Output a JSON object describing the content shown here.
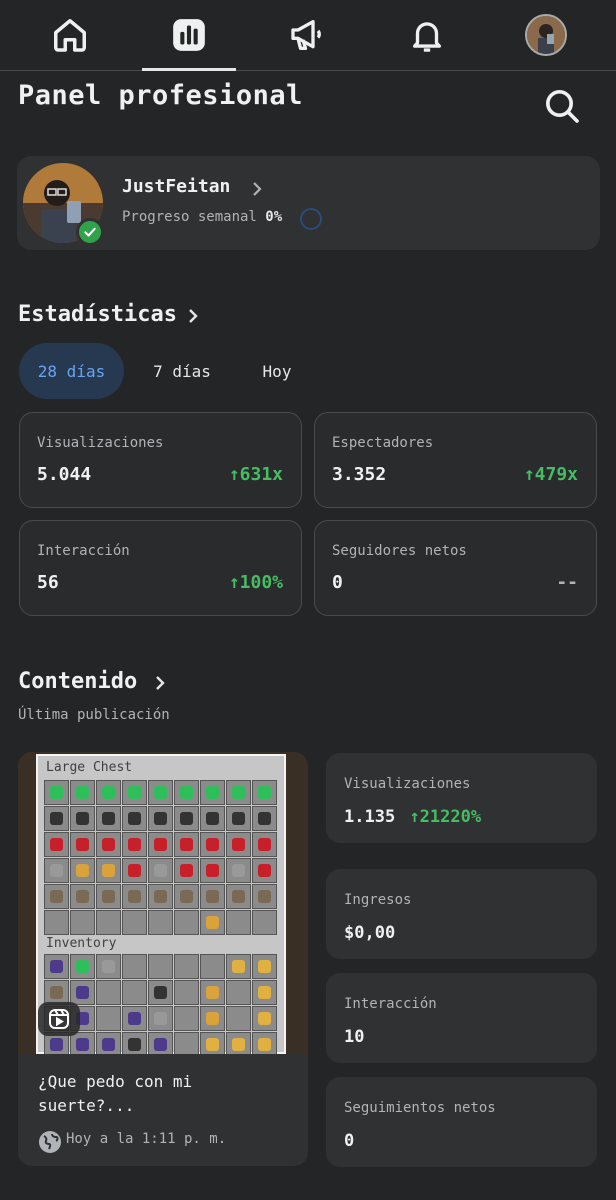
{
  "nav": {
    "items": [
      {
        "icon": "home-icon",
        "active": false
      },
      {
        "icon": "dashboard-icon",
        "active": true
      },
      {
        "icon": "megaphone-icon",
        "active": false
      },
      {
        "icon": "bell-icon",
        "active": false
      },
      {
        "icon": "profile-avatar",
        "active": false
      }
    ]
  },
  "page": {
    "title": "Panel profesional"
  },
  "profile": {
    "name": "JustFeitan",
    "progress_label": "Progreso semanal",
    "progress_value": "0%"
  },
  "stats": {
    "title": "Estadísticas",
    "tabs": [
      "28 días",
      "7 días",
      "Hoy"
    ],
    "active_tab": "28 días",
    "cards": [
      {
        "label": "Visualizaciones",
        "value": "5.044",
        "change": "↑631x"
      },
      {
        "label": "Espectadores",
        "value": "3.352",
        "change": "↑479x"
      },
      {
        "label": "Interacción",
        "value": "56",
        "change": "↑100%"
      },
      {
        "label": "Seguidores netos",
        "value": "0",
        "change": "--"
      }
    ]
  },
  "content": {
    "title": "Contenido",
    "subtitle": "Última publicación",
    "post": {
      "thumb_chest_label": "Large Chest",
      "thumb_inventory_label": "Inventory",
      "caption": "¿Que pedo con mi suerte?...",
      "time": "Hoy a la 1:11 p. m."
    },
    "metrics": [
      {
        "label": "Visualizaciones",
        "value": "1.135",
        "change": "↑21220%"
      },
      {
        "label": "Ingresos",
        "value": "$0,00",
        "change": ""
      },
      {
        "label": "Interacción",
        "value": "10",
        "change": ""
      },
      {
        "label": "Seguimientos netos",
        "value": "0",
        "change": ""
      }
    ]
  },
  "colors": {
    "background": "#242526",
    "card": "#303132",
    "positive": "#45bd62",
    "active_tab_bg": "#263951",
    "active_tab_text": "#6aa4f0",
    "verified": "#31a24c"
  }
}
